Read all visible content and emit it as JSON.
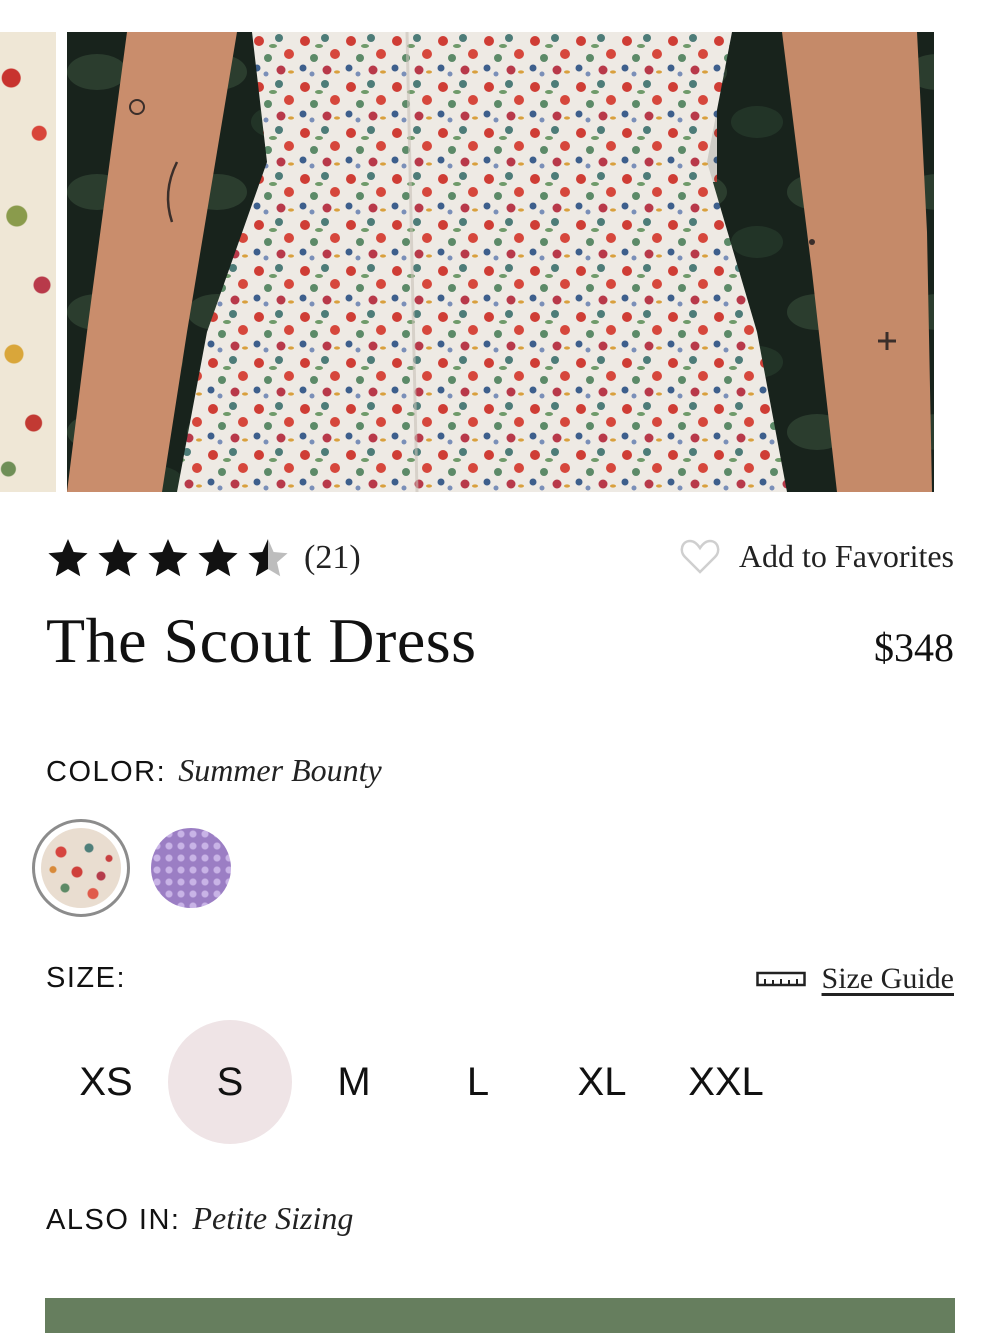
{
  "gallery": {
    "main_image_alt": "Model wearing a floral print dress",
    "prev_thumb_alt": "Fabric print detail"
  },
  "rating": {
    "value": 4.5,
    "max": 5,
    "review_count": "(21)"
  },
  "favorites": {
    "label": "Add to Favorites",
    "icon": "heart-outline-icon"
  },
  "product": {
    "title": "The Scout Dress",
    "price": "$348"
  },
  "color": {
    "label": "COLOR:",
    "selected_name": "Summer Bounty",
    "swatches": [
      {
        "name": "Summer Bounty",
        "selected": true
      },
      {
        "name": "Lilac Print",
        "selected": false
      }
    ]
  },
  "size": {
    "label": "SIZE:",
    "guide_label": "Size Guide",
    "guide_icon": "ruler-icon",
    "options": [
      "XS",
      "S",
      "M",
      "L",
      "XL",
      "XXL"
    ],
    "selected": "S"
  },
  "also_in": {
    "label": "ALSO IN:",
    "value": "Petite Sizing"
  },
  "colors": {
    "cta_green": "#667e5e",
    "selected_size_bg": "#efe4e6",
    "star": "#111111",
    "star_empty": "#bdbdbd"
  }
}
